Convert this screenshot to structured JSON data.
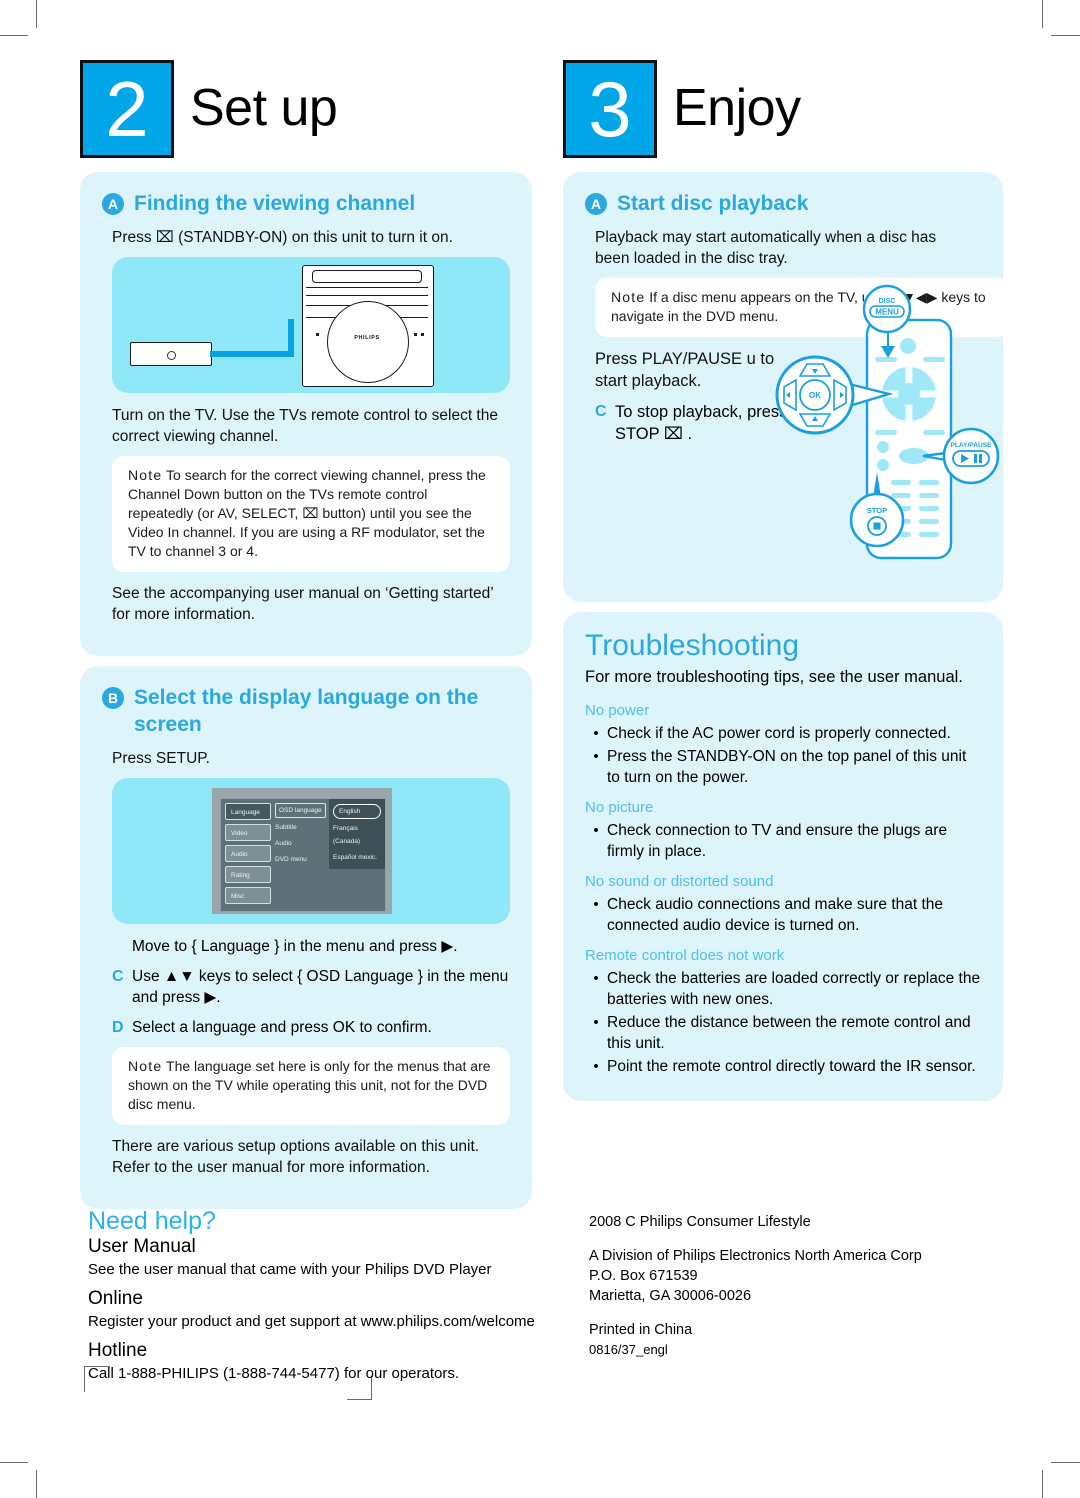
{
  "meta": {
    "doc_type": "quick-start-guide",
    "accent_blue": "#2aa8e0",
    "panel_bg": "#ddf4fb",
    "figure_bg": "#8ee8f7",
    "step_box_bg": "#00a6e8"
  },
  "step2": {
    "number": "2",
    "title": "Set up",
    "section_a": {
      "badge": "A",
      "title": "Finding the viewing channel",
      "line1": "Press ⌧  (STANDBY-ON) on this unit to turn it on.",
      "line2": "Turn on the TV. Use the TVs remote control to select the correct viewing channel.",
      "note_label": "Note",
      "note_text": "To search for the correct viewing channel, press the Channel Down button on the TVs remote control repeatedly (or AV, SELECT, ⌧   button) until you see the Video In channel. If you are using a RF modulator, set the TV to channel 3 or 4.",
      "line3": "See the accompanying user manual on ‘Getting started’ for more information.",
      "figure": {
        "brand": "PHILIPS",
        "caption": "main unit with standby-on button callout"
      }
    },
    "section_b": {
      "badge": "B",
      "title": "Select the display language on the screen",
      "line1": "Press SETUP.",
      "steps": [
        {
          "letter": "",
          "text": "Move to { Language } in the menu and press ▶."
        },
        {
          "letter": "C",
          "text": "Use ▲▼ keys to select { OSD Language } in the menu and press ▶."
        },
        {
          "letter": "D",
          "text": "Select a language and press OK to confirm."
        }
      ],
      "note_label": "Note",
      "note_text": "The language set here is only for the menus that are shown on the TV while operating this unit, not for the DVD disc menu.",
      "closing": "There are various setup options available on this unit. Refer to the user manual for more information.",
      "osd_menu": {
        "left_column": [
          "Language",
          "Video",
          "Audio",
          "Rating",
          "Misc"
        ],
        "middle_column": [
          "OSD language",
          "Subtitle",
          "Audio",
          "DVD menu"
        ],
        "right_column": [
          "English",
          "Français (Canada)",
          "Español mexic."
        ],
        "selected_left": "Language",
        "selected_middle": "OSD language",
        "selected_right": "English"
      }
    }
  },
  "step3": {
    "number": "3",
    "title": "Enjoy",
    "section_a": {
      "badge": "A",
      "title": "Start disc playback",
      "line1": "Playback may start automatically when a disc has been loaded in the disc tray.",
      "note_label": "Note",
      "note_text": "If a disc menu appears on the TV, use ▲▼◀▶ keys to navigate in the DVD menu.",
      "line2": "Press PLAY/PAUSE u to start playback.",
      "step_c_letter": "C",
      "step_c_text": "To stop playback, press STOP ⌧ .",
      "remote_callouts": {
        "disc_menu_l1": "DISC",
        "disc_menu_l2": "MENU",
        "ok": "OK",
        "play_pause": "PLAY/PAUSE",
        "stop": "STOP"
      }
    }
  },
  "troubleshooting": {
    "title": "Troubleshooting",
    "intro": "For more troubleshooting tips, see the user manual.",
    "bullet": "•",
    "groups": [
      {
        "heading": "No power",
        "items": [
          "Check if the AC power cord is properly connected.",
          "Press the STANDBY-ON on the top panel of this unit to turn on the power."
        ]
      },
      {
        "heading": "No picture",
        "items": [
          "Check connection to TV and ensure the plugs are firmly in place."
        ]
      },
      {
        "heading": "No sound or distorted sound",
        "items": [
          "Check audio connections and make sure that the connected audio device is turned on."
        ]
      },
      {
        "heading": "Remote control does not work",
        "items": [
          "Check the batteries are loaded correctly or replace the batteries with new ones.",
          "Reduce the distance between the remote control and this unit.",
          "Point the remote control directly toward the IR sensor."
        ]
      }
    ]
  },
  "need_help": {
    "title": "Need help?",
    "items": [
      {
        "label": "User Manual",
        "text": "See the user manual that came with your Philips DVD Player"
      },
      {
        "label": "Online",
        "text": "Register your product and get support at www.philips.com/welcome"
      },
      {
        "label": "Hotline",
        "text": "Call 1-888-PHILIPS (1-888-744-5477) for our operators."
      }
    ]
  },
  "legal": {
    "line1": "2008 C  Philips Consumer Lifestyle",
    "line2": "A Division of Philips Electronics North America Corp",
    "line3": "P.O. Box 671539",
    "line4": "Marietta, GA 30006-0026",
    "line5": "Printed in China",
    "line6": "0816/37_engl"
  }
}
